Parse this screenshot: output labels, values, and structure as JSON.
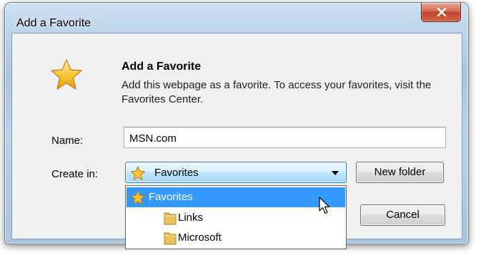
{
  "window": {
    "title": "Add a Favorite",
    "close_glyph": "X"
  },
  "content": {
    "heading": "Add a Favorite",
    "description": "Add this webpage as a favorite. To access your favorites, visit the Favorites Center."
  },
  "form": {
    "name_label": "Name:",
    "name_value": "MSN.com",
    "create_in_label": "Create in:",
    "create_in_value": "Favorites",
    "new_folder_button": "New folder",
    "cancel_button": "Cancel"
  },
  "dropdown": {
    "items": [
      {
        "label": "Favorites",
        "icon": "star-icon",
        "selected": true
      },
      {
        "label": "Links",
        "icon": "folder-icon",
        "selected": false
      },
      {
        "label": "Microsoft",
        "icon": "folder-icon",
        "selected": false
      }
    ]
  },
  "icons": {
    "header": "favorite-star-icon",
    "close": "close-icon",
    "combo_arrow": "chevron-down-icon",
    "cursor": "mouse-cursor-icon"
  },
  "colors": {
    "selection": "#3399ff",
    "star": "#f7c431",
    "folder": "#e8c25a",
    "close_button": "#c1432a"
  }
}
